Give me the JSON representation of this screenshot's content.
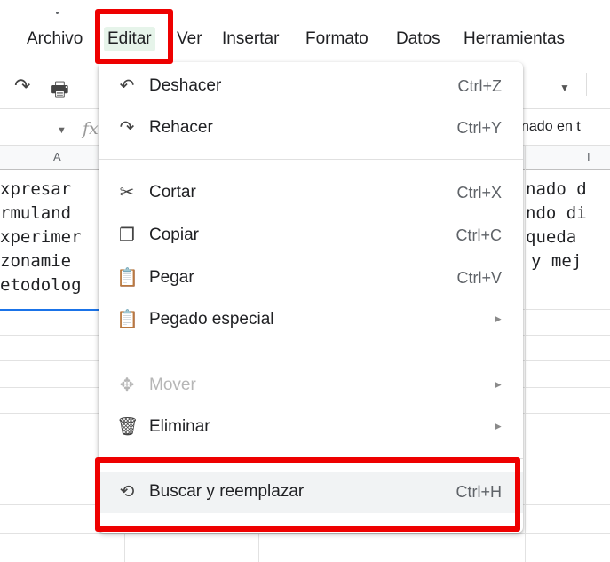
{
  "menubar": {
    "items": [
      "Archivo",
      "Editar",
      "Ver",
      "Insertar",
      "Formato",
      "Datos",
      "Herramientas"
    ]
  },
  "formula": {
    "fx": "fx",
    "right_text": "nado en t"
  },
  "grid": {
    "col_a": "A",
    "col_right": "I",
    "left_lines": [
      "xpresar",
      "rmuland",
      "xperimer",
      "zonamie",
      "etodolog"
    ],
    "right_lines": [
      "nado d",
      "ndo di",
      "queda",
      "y mej"
    ]
  },
  "menu": {
    "items": [
      {
        "label": "Deshacer",
        "shortcut": "Ctrl+Z",
        "icon": "undo-icon"
      },
      {
        "label": "Rehacer",
        "shortcut": "Ctrl+Y",
        "icon": "redo-icon"
      },
      {
        "label": "Cortar",
        "shortcut": "Ctrl+X",
        "icon": "scissors-icon"
      },
      {
        "label": "Copiar",
        "shortcut": "Ctrl+C",
        "icon": "copy-icon"
      },
      {
        "label": "Pegar",
        "shortcut": "Ctrl+V",
        "icon": "paste-icon"
      },
      {
        "label": "Pegado especial",
        "shortcut": "",
        "icon": "paste-special-icon"
      },
      {
        "label": "Mover",
        "shortcut": "",
        "icon": "move-icon"
      },
      {
        "label": "Eliminar",
        "shortcut": "",
        "icon": "trash-icon"
      },
      {
        "label": "Buscar y reemplazar",
        "shortcut": "Ctrl+H",
        "icon": "find-replace-icon"
      }
    ]
  },
  "colors": {
    "highlight": "#ee0000",
    "active_menu_bg": "#e6f4ea",
    "selection": "#1a73e8"
  }
}
